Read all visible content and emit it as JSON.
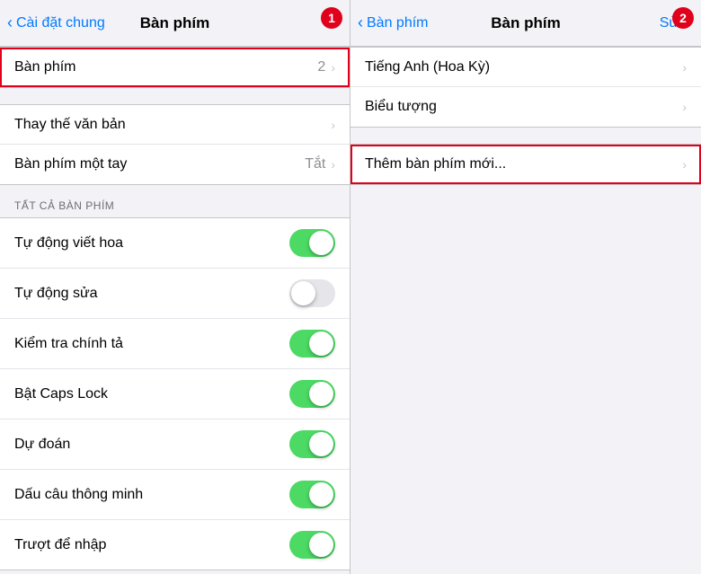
{
  "left": {
    "nav": {
      "back_label": "Cài đặt chung",
      "title": "Bàn phím"
    },
    "keyboard_row": {
      "label": "Bàn phím",
      "value": "2"
    },
    "replace_row": {
      "label": "Thay thế văn bản"
    },
    "one_hand_row": {
      "label": "Bàn phím một tay",
      "value": "Tắt"
    },
    "section_label": "TẤT CẢ BÀN PHÍM",
    "toggles": [
      {
        "label": "Tự động viết hoa",
        "on": true
      },
      {
        "label": "Tự động sửa",
        "on": false
      },
      {
        "label": "Kiểm tra chính tả",
        "on": true
      },
      {
        "label": "Bật Caps Lock",
        "on": true
      },
      {
        "label": "Dự đoán",
        "on": true
      },
      {
        "label": "Dấu câu thông minh",
        "on": true
      },
      {
        "label": "Trượt để nhập",
        "on": true
      }
    ],
    "badge": "1"
  },
  "right": {
    "nav": {
      "back_label": "Bàn phím",
      "title": "Bàn phím",
      "action_label": "Sửa"
    },
    "items": [
      {
        "label": "Tiếng Anh (Hoa Kỳ)"
      },
      {
        "label": "Biểu tượng"
      }
    ],
    "add_row": {
      "label": "Thêm bàn phím mới..."
    },
    "badge": "2"
  }
}
